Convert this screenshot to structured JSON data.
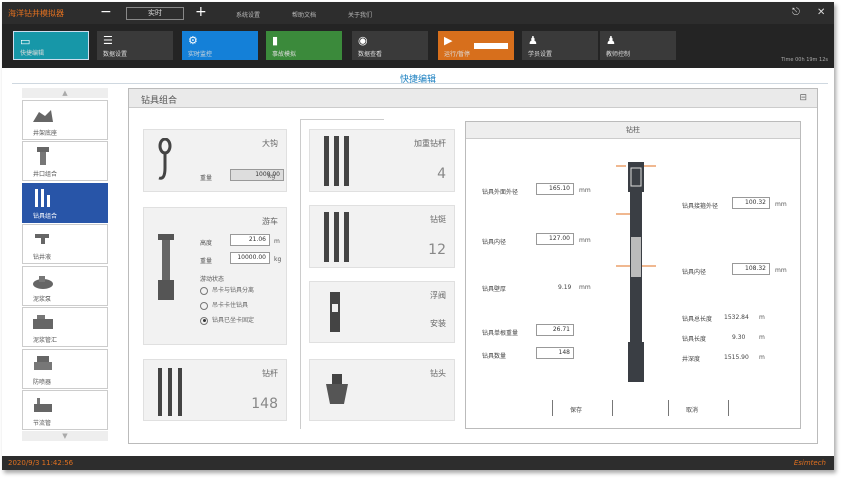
{
  "titlebar": {
    "app_title": "海洋钻井模拟器",
    "minus": "−",
    "sim_mode": "实时",
    "plus": "+",
    "menu": [
      "系统设置",
      "帮助文档",
      "关于我们"
    ]
  },
  "toolbar": {
    "buttons": [
      {
        "label": "快捷编辑"
      },
      {
        "label": "数据设置"
      },
      {
        "label": "实时监控"
      },
      {
        "label": "事故模拟"
      },
      {
        "label": "数据查看"
      },
      {
        "label": "运行/暂停"
      },
      {
        "label": "学员设置"
      },
      {
        "label": "教师控制"
      }
    ],
    "time_info": "Time 00h 19m 12s"
  },
  "page_title": "快捷编辑",
  "sidebar": {
    "items": [
      {
        "label": "井架底座"
      },
      {
        "label": "井口组合"
      },
      {
        "label": "钻具组合"
      },
      {
        "label": "钻井液"
      },
      {
        "label": "泥浆泵"
      },
      {
        "label": "泥浆管汇"
      },
      {
        "label": "防喷器"
      },
      {
        "label": "节流管"
      }
    ]
  },
  "main": {
    "heading": "钻具组合",
    "hook": {
      "title": "大钩",
      "weight_label": "重量",
      "weight_value": "1000.00",
      "weight_unit": "kg"
    },
    "elevator": {
      "title": "游车",
      "height_label": "高度",
      "height_value": "21.06",
      "height_unit": "m",
      "weight_label": "重量",
      "weight_value": "10000.00",
      "weight_unit": "kg",
      "state_label": "游动状态",
      "options": [
        "吊卡与钻具分离",
        "吊卡卡住钻具",
        "钻具已坐卡固定"
      ],
      "selected": 2
    },
    "drill_pipe": {
      "title": "钻杆",
      "count": "148"
    },
    "heavy_pipe": {
      "title": "加重钻杆",
      "count": "4"
    },
    "collar": {
      "title": "钻铤",
      "count": "12"
    },
    "float_valve": {
      "title": "浮阀",
      "status": "安装"
    },
    "bit": {
      "title": "钻头"
    },
    "drill_string": {
      "title": "钻柱",
      "outer_dia_label": "钻具外面外径",
      "outer_dia_value": "165.10",
      "outer_dia_unit": "mm",
      "inner_label": "钻具内径",
      "inner_value": "127.00",
      "inner_unit": "mm",
      "wall_label": "钻具壁厚",
      "wall_value": "9.19",
      "wall_unit": "mm",
      "single_weight_label": "钻具单根重量",
      "single_weight_value": "26.71",
      "count_label": "钻具数量",
      "count_value": "148",
      "joint_od_label": "钻具接箍外径",
      "joint_od_value": "100.32",
      "joint_od_unit": "mm",
      "joint_id_label": "钻具内径",
      "joint_id_value": "108.32",
      "joint_id_unit": "mm",
      "total_len_label": "钻具总长度",
      "total_len_value": "1532.84",
      "total_len_unit": "m",
      "len_label": "钻具长度",
      "len_value": "9.30",
      "len_unit": "m",
      "depth_label": "井深度",
      "depth_value": "1515.90",
      "depth_unit": "m",
      "confirm": "保存",
      "cancel": "取消"
    }
  },
  "status": {
    "datetime": "2020/9/3 11:42:56",
    "brand": "Esimtech"
  }
}
